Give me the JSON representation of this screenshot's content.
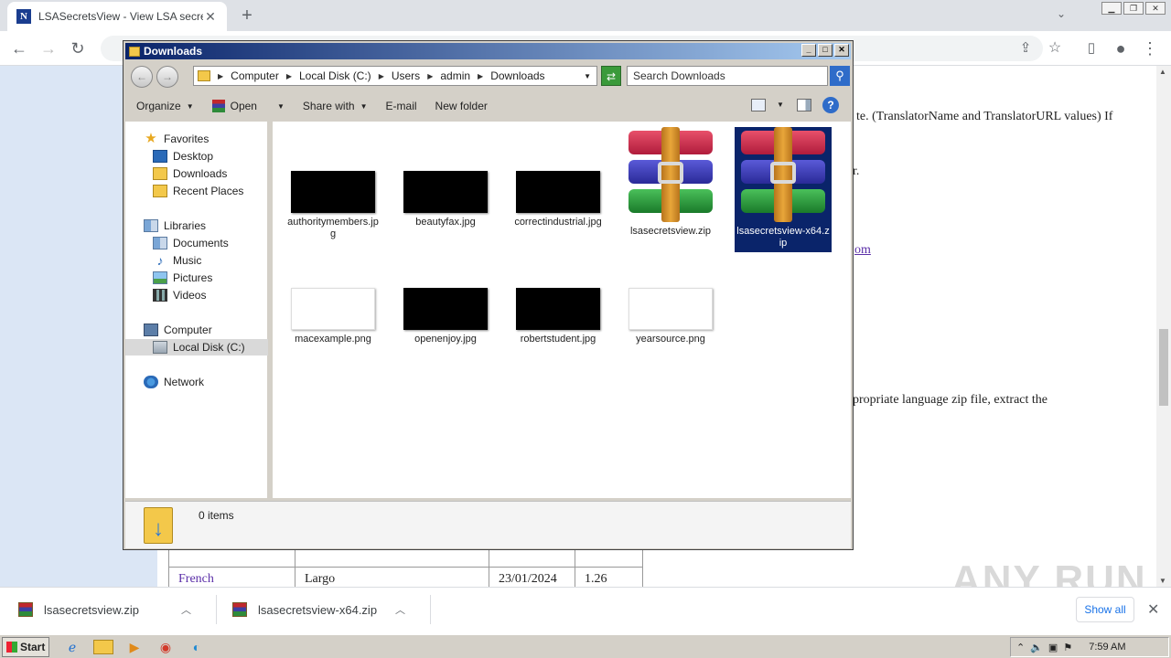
{
  "browser": {
    "tab_title": "LSASecretsView - View LSA secrets s",
    "tab_favicon": "N",
    "new_tab": "+",
    "page_fragments": {
      "line1": "te. (TranslatorName and TranslatorURL values) If",
      "line2": "r.",
      "line3": "om",
      "line4": "propriate language zip file, extract the"
    },
    "table_rows": [
      {
        "lang": "",
        "translator": "",
        "date": "",
        "version": ""
      },
      {
        "lang": "French",
        "translator": "Largo",
        "date": "23/01/2024",
        "version": "1.26"
      }
    ]
  },
  "downloads": {
    "items": [
      {
        "name": "lsasecretsview.zip"
      },
      {
        "name": "lsasecretsview-x64.zip"
      }
    ],
    "show_all": "Show all"
  },
  "watermark": "ANY RUN",
  "explorer": {
    "title": "Downloads",
    "breadcrumb": [
      "Computer",
      "Local Disk (C:)",
      "Users",
      "admin",
      "Downloads"
    ],
    "search_placeholder": "Search Downloads",
    "commands": {
      "organize": "Organize",
      "open": "Open",
      "share_with": "Share with",
      "email": "E-mail",
      "new_folder": "New folder"
    },
    "nav": {
      "favorites": "Favorites",
      "desktop": "Desktop",
      "downloads": "Downloads",
      "recent_places": "Recent Places",
      "libraries": "Libraries",
      "documents": "Documents",
      "music": "Music",
      "pictures": "Pictures",
      "videos": "Videos",
      "computer": "Computer",
      "local_disk": "Local Disk (C:)",
      "network": "Network"
    },
    "files": [
      {
        "name": "authoritymembers.jpg",
        "thumb": "dark"
      },
      {
        "name": "beautyfax.jpg",
        "thumb": "dark"
      },
      {
        "name": "correctindustrial.jpg",
        "thumb": "dark"
      },
      {
        "name": "lsasecretsview.zip",
        "thumb": "winrar"
      },
      {
        "name": "lsasecretsview-x64.zip",
        "thumb": "winrar",
        "selected": true
      },
      {
        "name": "macexample.png",
        "thumb": "light"
      },
      {
        "name": "openenjoy.jpg",
        "thumb": "dark"
      },
      {
        "name": "robertstudent.jpg",
        "thumb": "dark"
      },
      {
        "name": "yearsource.png",
        "thumb": "light"
      }
    ],
    "status": "0 items"
  },
  "taskbar": {
    "start": "Start",
    "clock": "7:59 AM"
  }
}
